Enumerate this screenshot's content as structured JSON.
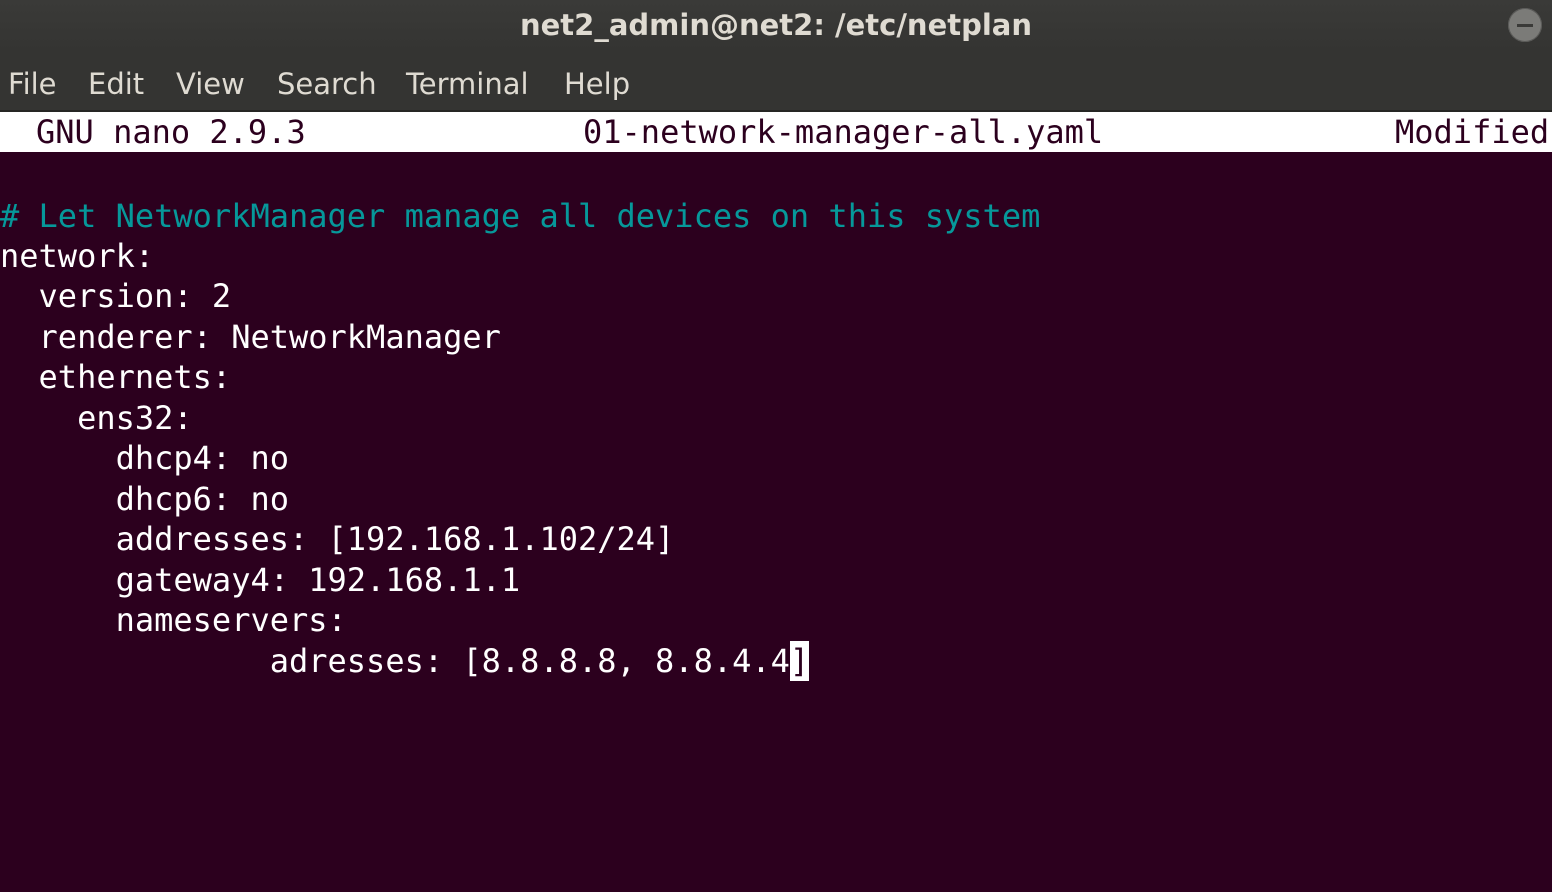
{
  "window": {
    "title": "net2_admin@net2: /etc/netplan"
  },
  "menu": {
    "items": [
      {
        "id": "file",
        "label": "File"
      },
      {
        "id": "edit",
        "label": "Edit"
      },
      {
        "id": "view",
        "label": "View"
      },
      {
        "id": "search",
        "label": "Search"
      },
      {
        "id": "terminal",
        "label": "Terminal"
      },
      {
        "id": "help",
        "label": "Help"
      }
    ]
  },
  "nano": {
    "version": "GNU nano 2.9.3",
    "filename": "01-network-manager-all.yaml",
    "status": "Modified"
  },
  "file_lines": {
    "comment": "# Let NetworkManager manage all devices on this system",
    "l1": "network:",
    "l2": "  version: 2",
    "l3": "  renderer: NetworkManager",
    "l4": "  ethernets:",
    "l5": "    ens32:",
    "l6": "      dhcp4: no",
    "l7": "      dhcp6: no",
    "l8": "      addresses: [192.168.1.102/24]",
    "l9": "      gateway4: 192.168.1.1",
    "l10": "      nameservers:",
    "l11_before": "              adresses: [8.8.8.8, 8.8.4.4",
    "l11_cursor": "]"
  },
  "colors": {
    "terminal_bg": "#2c001e",
    "comment": "#06989a",
    "text": "#ffffff",
    "titlebar": "#343432"
  }
}
